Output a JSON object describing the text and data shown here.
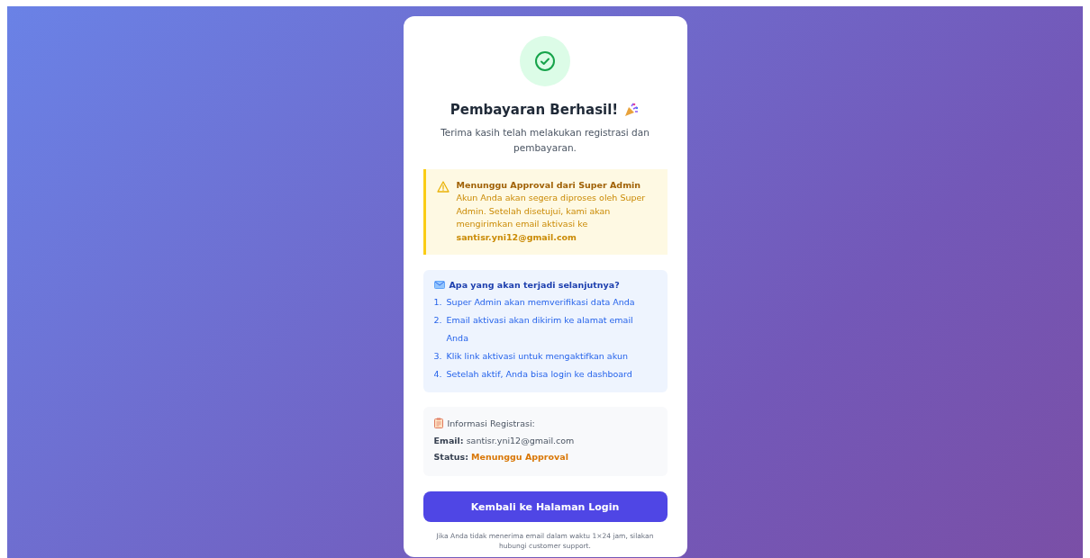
{
  "card": {
    "title": "Pembayaran Berhasil!",
    "subtitle": "Terima kasih telah melakukan registrasi dan pembayaran.",
    "warning": {
      "title": "Menunggu Approval dari Super Admin",
      "text": "Akun Anda akan segera diproses oleh Super Admin. Setelah disetujui, kami akan mengirimkan email aktivasi ke **santisr.yni12@gmail.com**"
    },
    "steps": {
      "title": "Apa yang akan terjadi selanjutnya?",
      "items": [
        {
          "number": "1.",
          "text": "Super Admin akan memverifikasi data Anda"
        },
        {
          "number": "2.",
          "text": "Email aktivasi akan dikirim ke alamat email Anda"
        },
        {
          "number": "3.",
          "text": "Klik link aktivasi untuk mengaktifkan akun"
        },
        {
          "number": "4.",
          "text": "Setelah aktif, Anda bisa login ke dashboard"
        }
      ]
    },
    "info": {
      "title": "Informasi Registrasi:",
      "rows": [
        {
          "label": "Email:",
          "value": "santisr.yni12@gmail.com",
          "kind": "plain"
        },
        {
          "label": "Status:",
          "value": "Menunggu Approval",
          "kind": "status"
        }
      ]
    },
    "button": "Kembali ke Halaman Login",
    "footnote": "Jika Anda tidak menerima email dalam waktu 1×24 jam, silakan hubungi customer support."
  }
}
